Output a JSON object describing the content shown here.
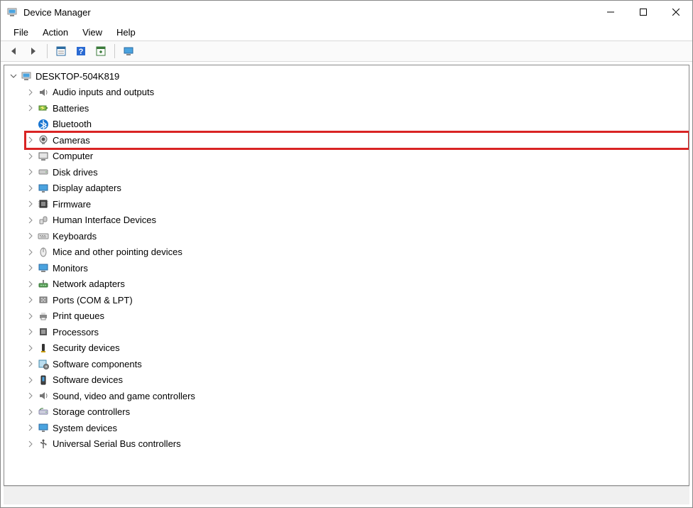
{
  "window": {
    "title": "Device Manager"
  },
  "menu": {
    "file": "File",
    "action": "Action",
    "view": "View",
    "help": "Help"
  },
  "toolbar": {
    "back": "Back",
    "forward": "Forward",
    "properties": "Properties",
    "help": "Help",
    "scan": "Scan for hardware changes",
    "monitor": "Show hidden devices"
  },
  "root": {
    "name": "DESKTOP-504K819",
    "expanded": true
  },
  "categories": [
    {
      "key": "audio",
      "label": "Audio inputs and outputs",
      "icon": "speaker",
      "highlighted": false
    },
    {
      "key": "batteries",
      "label": "Batteries",
      "icon": "battery",
      "highlighted": false
    },
    {
      "key": "bluetooth",
      "label": "Bluetooth",
      "icon": "bluetooth",
      "highlighted": false,
      "noTwisty": true
    },
    {
      "key": "cameras",
      "label": "Cameras",
      "icon": "camera",
      "highlighted": true
    },
    {
      "key": "computer",
      "label": "Computer",
      "icon": "computer",
      "highlighted": false
    },
    {
      "key": "disk",
      "label": "Disk drives",
      "icon": "disk",
      "highlighted": false
    },
    {
      "key": "display",
      "label": "Display adapters",
      "icon": "display",
      "highlighted": false
    },
    {
      "key": "firmware",
      "label": "Firmware",
      "icon": "chip",
      "highlighted": false
    },
    {
      "key": "hid",
      "label": "Human Interface Devices",
      "icon": "hid",
      "highlighted": false
    },
    {
      "key": "keyboards",
      "label": "Keyboards",
      "icon": "keyboard",
      "highlighted": false
    },
    {
      "key": "mice",
      "label": "Mice and other pointing devices",
      "icon": "mouse",
      "highlighted": false
    },
    {
      "key": "monitors",
      "label": "Monitors",
      "icon": "monitor",
      "highlighted": false
    },
    {
      "key": "network",
      "label": "Network adapters",
      "icon": "network",
      "highlighted": false
    },
    {
      "key": "ports",
      "label": "Ports (COM & LPT)",
      "icon": "port",
      "highlighted": false
    },
    {
      "key": "print",
      "label": "Print queues",
      "icon": "printer",
      "highlighted": false
    },
    {
      "key": "cpu",
      "label": "Processors",
      "icon": "cpu",
      "highlighted": false
    },
    {
      "key": "security",
      "label": "Security devices",
      "icon": "security",
      "highlighted": false
    },
    {
      "key": "swcomp",
      "label": "Software components",
      "icon": "swcomp",
      "highlighted": false
    },
    {
      "key": "swdev",
      "label": "Software devices",
      "icon": "swdev",
      "highlighted": false
    },
    {
      "key": "sound",
      "label": "Sound, video and game controllers",
      "icon": "speaker",
      "highlighted": false
    },
    {
      "key": "storage",
      "label": "Storage controllers",
      "icon": "storage",
      "highlighted": false
    },
    {
      "key": "system",
      "label": "System devices",
      "icon": "system",
      "highlighted": false
    },
    {
      "key": "usb",
      "label": "Universal Serial Bus controllers",
      "icon": "usb",
      "highlighted": false
    }
  ],
  "statusbar": ""
}
